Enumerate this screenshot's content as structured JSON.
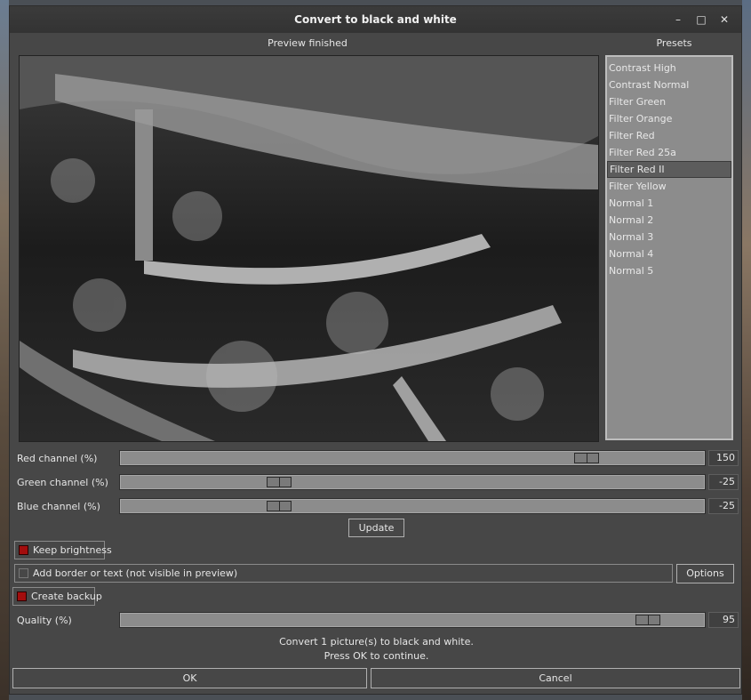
{
  "window": {
    "title": "Convert to black and white"
  },
  "titlebar": {
    "minimize_icon": "minimize-icon",
    "maximize_icon": "maximize-icon",
    "close_icon": "close-icon"
  },
  "preview": {
    "label": "Preview finished"
  },
  "presets": {
    "label": "Presets",
    "items": [
      "Contrast High",
      "Contrast Normal",
      "Filter Green",
      "Filter Orange",
      "Filter Red",
      "Filter Red 25a",
      "Filter Red II",
      "Filter Yellow",
      "Normal 1",
      "Normal 2",
      "Normal 3",
      "Normal 4",
      "Normal 5"
    ],
    "selected": "Filter Red II"
  },
  "channels": {
    "red": {
      "label": "Red channel (%)",
      "value": "150",
      "fraction": 0.81
    },
    "green": {
      "label": "Green channel (%)",
      "value": "-25",
      "fraction": 0.26
    },
    "blue": {
      "label": "Blue channel (%)",
      "value": "-25",
      "fraction": 0.26
    }
  },
  "update_button": "Update",
  "keep_brightness": {
    "label": "Keep brightness",
    "checked": true
  },
  "border_text": {
    "label": "Add border or text (not visible in preview)",
    "checked": false
  },
  "options_button": "Options",
  "create_backup": {
    "label": "Create backup",
    "checked": true
  },
  "quality": {
    "label": "Quality (%)",
    "value": "95",
    "fraction": 0.92
  },
  "status": {
    "line1": "Convert 1 picture(s) to black and white.",
    "line2": "Press OK to continue."
  },
  "ok_button": "OK",
  "cancel_button": "Cancel"
}
